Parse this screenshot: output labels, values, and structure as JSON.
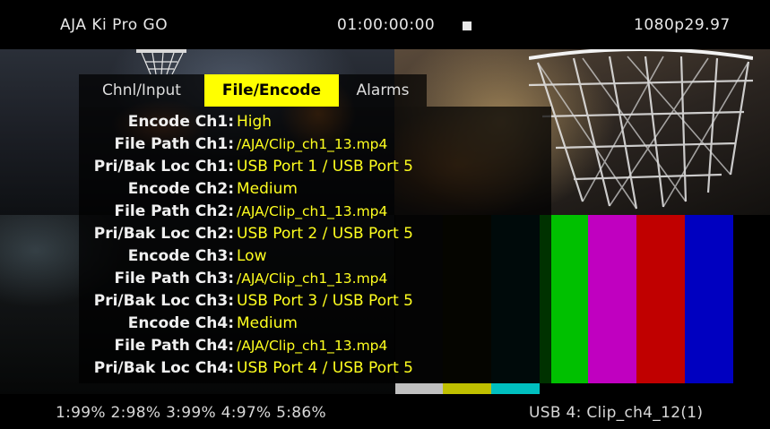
{
  "header": {
    "device": "AJA Ki Pro GO",
    "timecode": "01:00:00:00",
    "format": "1080p29.97",
    "transport_state_icon": "stop-icon"
  },
  "tabs": [
    {
      "label": "Chnl/Input",
      "active": false
    },
    {
      "label": "File/Encode",
      "active": true
    },
    {
      "label": "Alarms",
      "active": false
    }
  ],
  "settings": [
    {
      "label": "Encode Ch1:",
      "value": "High"
    },
    {
      "label": "File Path Ch1:",
      "value": "/AJA/Clip_ch1_13.mp4"
    },
    {
      "label": "Pri/Bak Loc Ch1:",
      "value": "USB Port 1  /  USB Port 5"
    },
    {
      "label": "Encode Ch2:",
      "value": "Medium"
    },
    {
      "label": "File Path Ch2:",
      "value": "/AJA/Clip_ch1_13.mp4"
    },
    {
      "label": "Pri/Bak Loc Ch2:",
      "value": "USB Port 2  /  USB Port 5"
    },
    {
      "label": "Encode Ch3:",
      "value": "Low"
    },
    {
      "label": "File Path Ch3:",
      "value": "/AJA/Clip_ch1_13.mp4"
    },
    {
      "label": "Pri/Bak Loc Ch3:",
      "value": "USB Port 3  /  USB Port 5"
    },
    {
      "label": "Encode Ch4:",
      "value": "Medium"
    },
    {
      "label": "File Path Ch4:",
      "value": "/AJA/Clip_ch1_13.mp4"
    },
    {
      "label": "Pri/Bak Loc Ch4:",
      "value": "USB Port 4  /  USB Port 5"
    }
  ],
  "footer": {
    "storage": "1:99% 2:98% 3:99% 4:97% 5:86%",
    "clip": "USB  4:  Clip_ch4_12(1)"
  },
  "colors": {
    "accent": "#ffff00",
    "value_text": "#ffff1f",
    "color_bars": [
      "#c0c0c0",
      "#c0c000",
      "#00c0c0",
      "#00c000",
      "#c000c0",
      "#c00000",
      "#0000c0"
    ]
  }
}
